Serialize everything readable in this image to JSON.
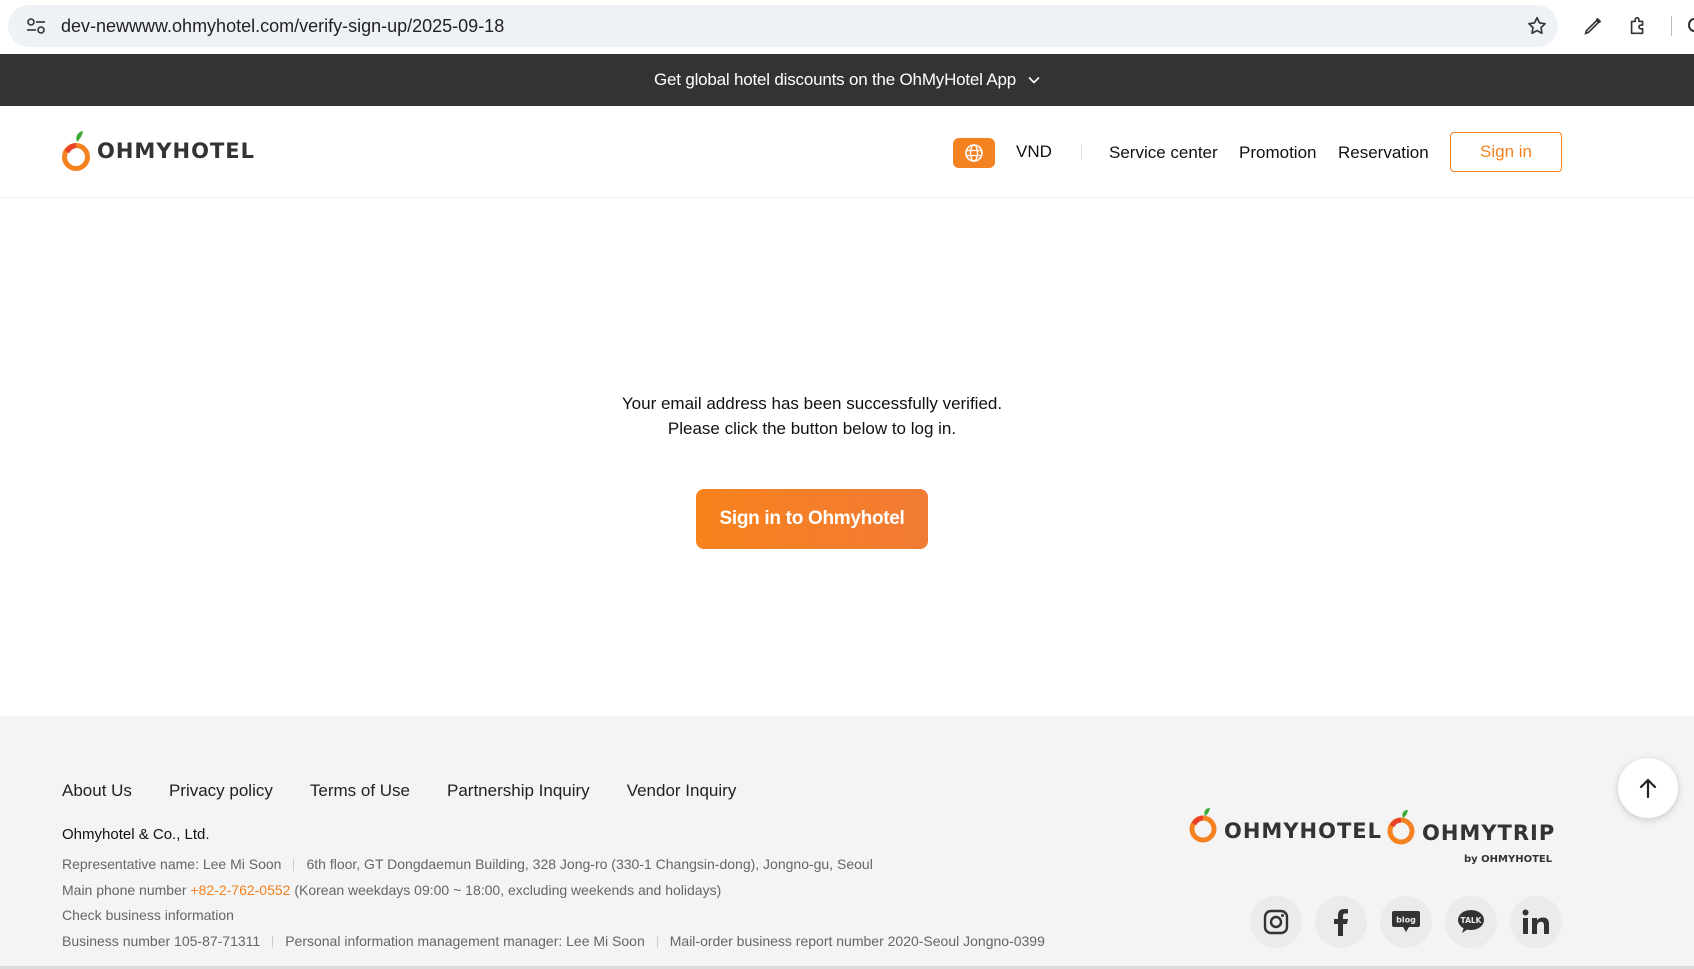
{
  "browser": {
    "url": "dev-newwww.ohmyhotel.com/verify-sign-up/2025-09-18"
  },
  "promo": {
    "text": "Get global hotel discounts on the OhMyHotel App"
  },
  "header": {
    "logo_text": "OHMYHOTEL",
    "currency": "VND",
    "nav": {
      "service_center": "Service center",
      "promotion": "Promotion",
      "reservation": "Reservation"
    },
    "sign_in": "Sign in"
  },
  "main": {
    "line1": "Your email address has been successfully verified.",
    "line2": "Please click the button below to log in.",
    "cta": "Sign in to Ohmyhotel"
  },
  "footer": {
    "links": [
      "About Us",
      "Privacy policy",
      "Terms of Use",
      "Partnership Inquiry",
      "Vendor Inquiry"
    ],
    "company": "Ohmyhotel & Co., Ltd.",
    "representative": "Representative name: Lee Mi Soon",
    "address": "6th floor, GT Dongdaemun Building, 328 Jong-ro (330-1 Changsin-dong), Jongno-gu, Seoul",
    "phone_label": "Main phone number",
    "phone": "+82-2-762-0552",
    "phone_hours": "(Korean weekdays 09:00 ~ 18:00, excluding weekends and holidays)",
    "check_business": "Check business information",
    "business_number": "Business number 105-87-71311",
    "privacy_manager": "Personal information management manager: Lee Mi Soon",
    "mail_order": "Mail-order business report number 2020-Seoul Jongno-0399",
    "logo1": "OHMYHOTEL",
    "logo2": "OHMYTRIP",
    "logo2_by": "by OHMYHOTEL",
    "social": [
      "instagram-icon",
      "facebook-icon",
      "blog-icon",
      "talk-icon",
      "linkedin-icon"
    ]
  },
  "colors": {
    "accent": "#f58220",
    "promo_bg": "#333333",
    "footer_bg": "#f4f4f4"
  }
}
